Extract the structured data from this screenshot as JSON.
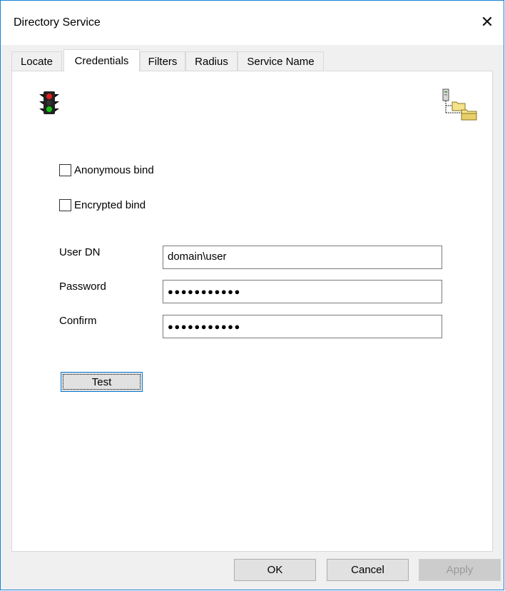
{
  "window": {
    "title": "Directory Service"
  },
  "tabs": [
    {
      "label": "Locate"
    },
    {
      "label": "Credentials"
    },
    {
      "label": "Filters"
    },
    {
      "label": "Radius"
    },
    {
      "label": "Service Name"
    }
  ],
  "active_tab": "Credentials",
  "options": {
    "anonymous_bind": {
      "label": "Anonymous bind",
      "checked": false
    },
    "encrypted_bind": {
      "label": "Encrypted bind",
      "checked": false
    }
  },
  "fields": {
    "user_dn": {
      "label": "User DN",
      "value": "domain\\user"
    },
    "password": {
      "label": "Password",
      "value": "●●●●●●●●●●●"
    },
    "confirm": {
      "label": "Confirm",
      "value": "●●●●●●●●●●●"
    }
  },
  "buttons": {
    "test": "Test",
    "ok": "OK",
    "cancel": "Cancel",
    "apply": "Apply"
  },
  "icons": {
    "status": "traffic-light-icon",
    "directory": "directory-tree-icon"
  }
}
